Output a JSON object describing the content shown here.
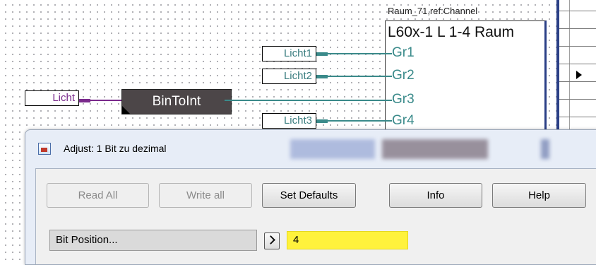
{
  "schematic": {
    "input_label": "Licht",
    "block_label": "BinToInt",
    "outputs": [
      "Licht1",
      "Licht2",
      "Licht3"
    ],
    "channel": {
      "title": "Raum_71,ref:Channel",
      "label": "L60x-1 L 1-4 Raum",
      "groups": [
        "Gr1",
        "Gr2",
        "Gr3",
        "Gr4"
      ]
    }
  },
  "dialog": {
    "title": "Adjust: 1 Bit zu dezimal",
    "buttons": {
      "read_all": "Read All",
      "write_all": "Write all",
      "set_defaults": "Set Defaults",
      "info": "Info",
      "help": "Help"
    },
    "parameter": {
      "label": "Bit Position...",
      "value": "4"
    }
  },
  "colors": {
    "wire_green": "#3a8a8a",
    "wire_purple": "#7a2a8c",
    "block_bg": "#4c4648",
    "value_highlight": "#fff23c",
    "channel_border": "#2a3f86"
  }
}
